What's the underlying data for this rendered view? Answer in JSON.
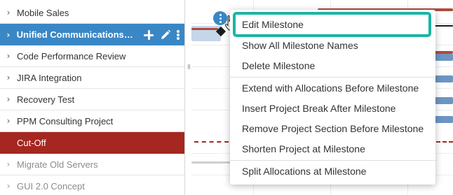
{
  "project_list": {
    "rows": [
      {
        "label": "Mobile Sales",
        "state": "normal"
      },
      {
        "label": "Unified Communications Migration",
        "state": "selected"
      },
      {
        "label": "Code Performance Review",
        "state": "normal"
      },
      {
        "label": "JIRA Integration",
        "state": "normal"
      },
      {
        "label": "Recovery Test",
        "state": "normal"
      },
      {
        "label": "PPM Consulting Project",
        "state": "normal"
      },
      {
        "label": "Cut-Off",
        "state": "cutoff"
      },
      {
        "label": "Migrate Old Servers",
        "state": "dim"
      },
      {
        "label": "GUI 2.0 Concept",
        "state": "dim"
      }
    ],
    "selected_row_icons": [
      "plus-icon",
      "pencil-icon",
      "kebab-icon"
    ]
  },
  "context_menu": {
    "items": [
      {
        "label": "Edit Milestone",
        "highlighted": true
      },
      {
        "label": "Show All Milestone Names"
      },
      {
        "label": "Delete Milestone"
      },
      {
        "label": "Extend with Allocations Before Milestone"
      },
      {
        "label": "Insert Project Break After Milestone"
      },
      {
        "label": "Remove Project Section Before Milestone"
      },
      {
        "label": "Shorten Project at Milestone"
      },
      {
        "label": "Split Allocations at Milestone"
      }
    ]
  },
  "colors": {
    "selected_row": "#3a87c6",
    "cutoff_row": "#a5271f",
    "highlight_outline": "#1ab5a5",
    "bar_blue": "#6d95c3",
    "bar_red": "#b04a3f"
  }
}
